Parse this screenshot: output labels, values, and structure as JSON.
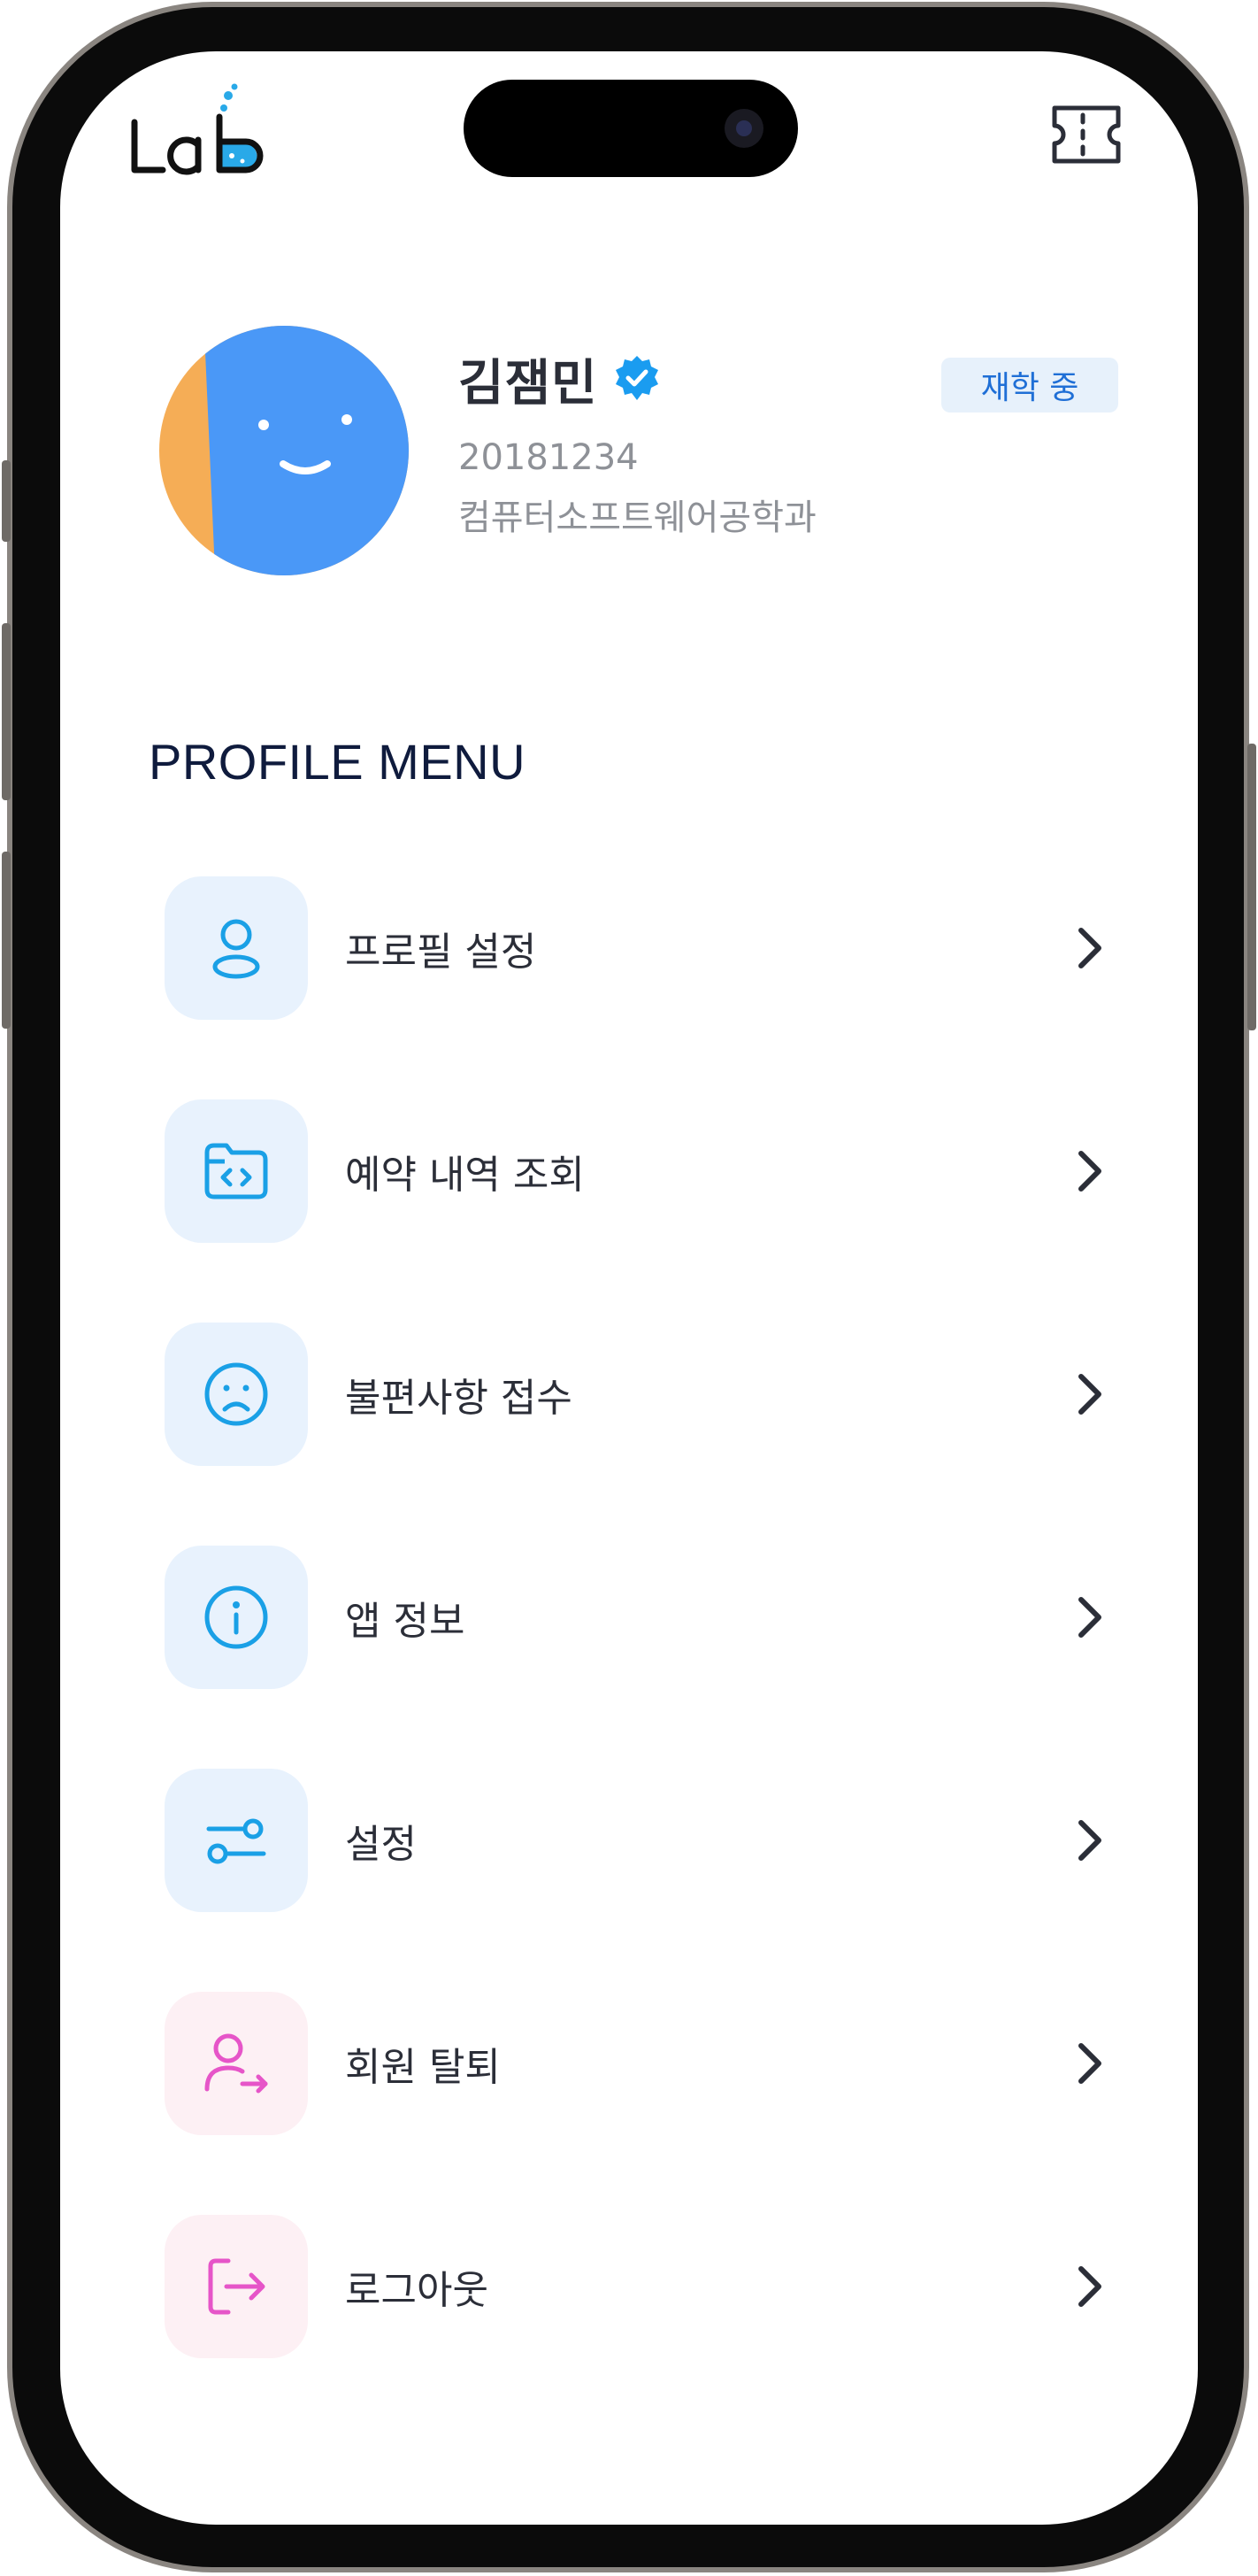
{
  "profile": {
    "name": "김잼민",
    "student_id": "20181234",
    "department": "컴퓨터소프트웨어공학과",
    "status": "재학 중"
  },
  "section_title": "PROFILE MENU",
  "menu": [
    {
      "label": "프로필 설정",
      "icon": "user-icon",
      "tone": "blue"
    },
    {
      "label": "예약 내역 조회",
      "icon": "code-folder-icon",
      "tone": "blue"
    },
    {
      "label": "불편사항 접수",
      "icon": "sad-face-icon",
      "tone": "blue"
    },
    {
      "label": "앱 정보",
      "icon": "info-icon",
      "tone": "blue"
    },
    {
      "label": "설정",
      "icon": "toggles-icon",
      "tone": "blue"
    },
    {
      "label": "회원 탈퇴",
      "icon": "user-leave-icon",
      "tone": "pink"
    },
    {
      "label": "로그아웃",
      "icon": "logout-icon",
      "tone": "pink"
    }
  ],
  "colors": {
    "accent_blue": "#1aa0e6",
    "accent_pink": "#e655c8",
    "avatar_blue": "#4a98f7",
    "avatar_orange": "#f5ad56",
    "badge_text": "#1f6fd6"
  }
}
